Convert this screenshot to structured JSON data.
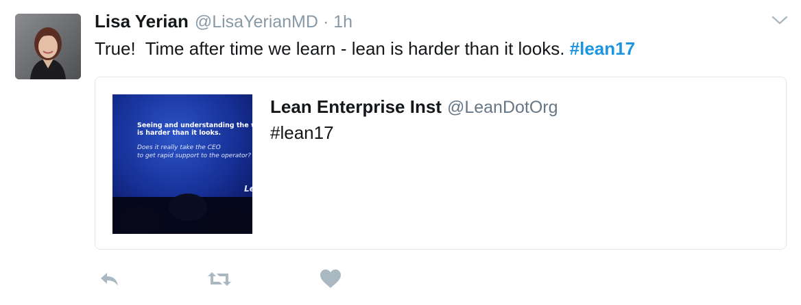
{
  "tweet": {
    "author_name": "Lisa Yerian",
    "author_handle": "@LisaYerianMD",
    "separator": "·",
    "timestamp": "1h",
    "text": "True!  Time after time we learn - lean is harder than it looks. ",
    "hashtag": "#lean17"
  },
  "quoted_tweet": {
    "author_name": "Lean Enterprise Inst",
    "author_handle": "@LeanDotOrg",
    "text": "#lean17",
    "media_slide": {
      "line1": "Seeing and understanding the work",
      "line2": "is harder than it looks.",
      "line3": "Does it really take the CEO",
      "line4": "to get rapid support to the operator?",
      "logo_fragment": "Le"
    }
  },
  "icons": {
    "more": "chevron-down-icon",
    "reply": "reply-icon",
    "retweet": "retweet-icon",
    "like": "heart-icon"
  },
  "colors": {
    "link": "#1b95e0",
    "secondary_text": "#8899a6",
    "action_icon": "#aab8c2",
    "card_border": "#e1e8ed"
  }
}
